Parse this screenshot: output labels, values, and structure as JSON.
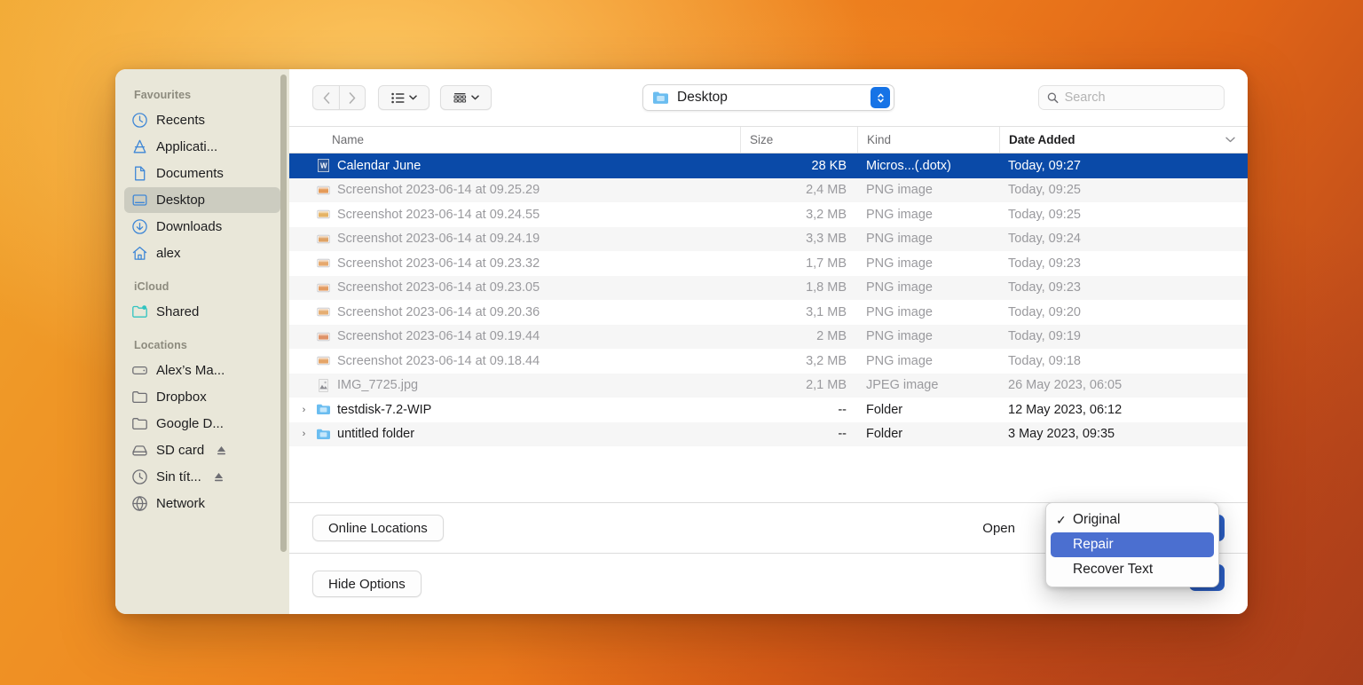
{
  "sidebar": {
    "groups": [
      {
        "title": "Favourites",
        "items": [
          {
            "label": "Recents",
            "icon": "clock-icon",
            "active": false
          },
          {
            "label": "Applicati...",
            "icon": "applications-icon",
            "active": false
          },
          {
            "label": "Documents",
            "icon": "document-icon",
            "active": false
          },
          {
            "label": "Desktop",
            "icon": "desktop-icon",
            "active": true
          },
          {
            "label": "Downloads",
            "icon": "download-icon",
            "active": false
          },
          {
            "label": "alex",
            "icon": "home-icon",
            "active": false
          }
        ]
      },
      {
        "title": "iCloud",
        "items": [
          {
            "label": "Shared",
            "icon": "shared-folder-icon",
            "active": false
          }
        ]
      },
      {
        "title": "Locations",
        "items": [
          {
            "label": "Alex’s Ma...",
            "icon": "computer-icon",
            "active": false
          },
          {
            "label": "Dropbox",
            "icon": "folder-icon",
            "active": false
          },
          {
            "label": "Google D...",
            "icon": "folder-icon",
            "active": false
          },
          {
            "label": "SD card",
            "icon": "disk-icon",
            "active": false,
            "eject": true
          },
          {
            "label": "Sin tít...",
            "icon": "timemachine-icon",
            "active": false,
            "eject": true
          },
          {
            "label": "Network",
            "icon": "network-icon",
            "active": false
          }
        ]
      }
    ]
  },
  "toolbar": {
    "back_icon": "chevron-left-icon",
    "forward_icon": "chevron-right-icon",
    "list_view_icon": "list-view-icon",
    "group_view_icon": "group-view-icon",
    "path_label": "Desktop",
    "path_icon": "folder-blue-icon",
    "stepper_icon": "up-down-chevron-icon"
  },
  "search": {
    "placeholder": "Search",
    "value": "",
    "icon": "search-icon"
  },
  "columns": {
    "name": "Name",
    "size": "Size",
    "kind": "Kind",
    "date": "Date Added",
    "sort_icon": "chevron-down-icon"
  },
  "files": [
    {
      "name": "Calendar June",
      "size": "28 KB",
      "kind": "Micros...(.dotx)",
      "date": "Today, 09:27",
      "icon": "word-doc-icon",
      "selected": true,
      "enabled": true,
      "folder": false
    },
    {
      "name": "Screenshot 2023-06-14 at 09.25.29",
      "size": "2,4 MB",
      "kind": "PNG image",
      "date": "Today, 09:25",
      "icon": "png-thumb-icon",
      "selected": false,
      "enabled": false,
      "folder": false
    },
    {
      "name": "Screenshot 2023-06-14 at 09.24.55",
      "size": "3,2 MB",
      "kind": "PNG image",
      "date": "Today, 09:25",
      "icon": "png-thumb-icon",
      "selected": false,
      "enabled": false,
      "folder": false
    },
    {
      "name": "Screenshot 2023-06-14 at 09.24.19",
      "size": "3,3 MB",
      "kind": "PNG image",
      "date": "Today, 09:24",
      "icon": "png-thumb-icon",
      "selected": false,
      "enabled": false,
      "folder": false
    },
    {
      "name": "Screenshot 2023-06-14 at 09.23.32",
      "size": "1,7 MB",
      "kind": "PNG image",
      "date": "Today, 09:23",
      "icon": "png-thumb-icon",
      "selected": false,
      "enabled": false,
      "folder": false
    },
    {
      "name": "Screenshot 2023-06-14 at 09.23.05",
      "size": "1,8 MB",
      "kind": "PNG image",
      "date": "Today, 09:23",
      "icon": "png-thumb-icon",
      "selected": false,
      "enabled": false,
      "folder": false
    },
    {
      "name": "Screenshot 2023-06-14 at 09.20.36",
      "size": "3,1 MB",
      "kind": "PNG image",
      "date": "Today, 09:20",
      "icon": "png-thumb-icon",
      "selected": false,
      "enabled": false,
      "folder": false
    },
    {
      "name": "Screenshot 2023-06-14 at 09.19.44",
      "size": "2 MB",
      "kind": "PNG image",
      "date": "Today, 09:19",
      "icon": "png-thumb-icon",
      "selected": false,
      "enabled": false,
      "folder": false
    },
    {
      "name": "Screenshot 2023-06-14 at 09.18.44",
      "size": "3,2 MB",
      "kind": "PNG image",
      "date": "Today, 09:18",
      "icon": "png-thumb-icon",
      "selected": false,
      "enabled": false,
      "folder": false
    },
    {
      "name": "IMG_7725.jpg",
      "size": "2,1 MB",
      "kind": "JPEG image",
      "date": "26 May 2023, 06:05",
      "icon": "jpeg-thumb-icon",
      "selected": false,
      "enabled": false,
      "folder": false
    },
    {
      "name": "testdisk-7.2-WIP",
      "size": "--",
      "kind": "Folder",
      "date": "12 May 2023, 06:12",
      "icon": "folder-blue-icon",
      "selected": false,
      "enabled": true,
      "folder": true
    },
    {
      "name": "untitled folder",
      "size": "--",
      "kind": "Folder",
      "date": "3 May 2023, 09:35",
      "icon": "folder-blue-icon",
      "selected": false,
      "enabled": true,
      "folder": true
    }
  ],
  "footer": {
    "online_locations": "Online Locations",
    "hide_options": "Hide Options",
    "open_label": "Open",
    "cancel_button": "",
    "open_button": ""
  },
  "menu": {
    "items": [
      {
        "label": "Original",
        "checked": true,
        "highlighted": false,
        "check_icon": "checkmark-icon"
      },
      {
        "label": "Repair",
        "checked": false,
        "highlighted": true,
        "check_icon": ""
      },
      {
        "label": "Recover Text",
        "checked": false,
        "highlighted": false,
        "check_icon": ""
      }
    ]
  },
  "colors": {
    "selection_blue": "#0a4aa8",
    "menu_highlight": "#4b6fd0",
    "accent_button": "#2c5fc4",
    "sidebar_bg": "#e9e7d9"
  }
}
